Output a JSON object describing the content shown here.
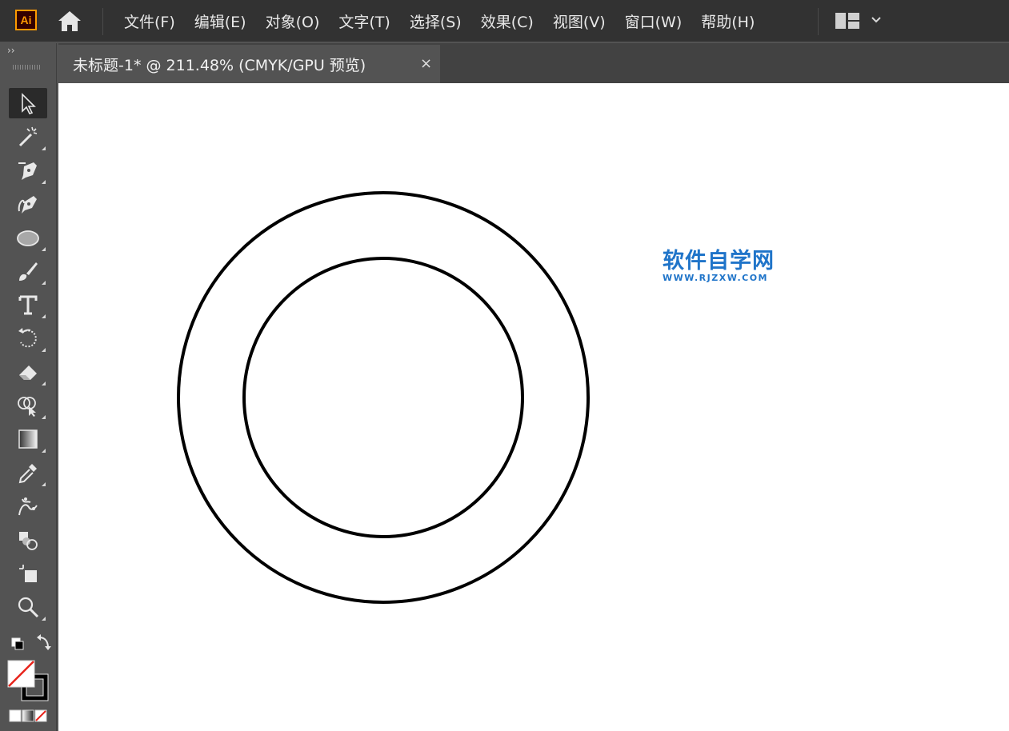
{
  "app": {
    "logo_text": "Ai",
    "colors": {
      "accent": "#ff9a00",
      "menubar_bg": "#323232",
      "panel_bg": "#535353",
      "watermark": "#1f74c9"
    }
  },
  "menu": {
    "items": [
      {
        "label": "文件(F)"
      },
      {
        "label": "编辑(E)"
      },
      {
        "label": "对象(O)"
      },
      {
        "label": "文字(T)"
      },
      {
        "label": "选择(S)"
      },
      {
        "label": "效果(C)"
      },
      {
        "label": "视图(V)"
      },
      {
        "label": "窗口(W)"
      },
      {
        "label": "帮助(H)"
      }
    ]
  },
  "toolbar": {
    "collapse_label": "››",
    "tools": [
      {
        "name": "selection-tool",
        "icon": "arrow-pointer-icon",
        "active": true
      },
      {
        "name": "magic-wand-tool",
        "icon": "magic-wand-icon"
      },
      {
        "name": "pen-tool",
        "icon": "pen-icon"
      },
      {
        "name": "curvature-tool",
        "icon": "curvature-pen-icon"
      },
      {
        "name": "ellipse-tool",
        "icon": "ellipse-icon"
      },
      {
        "name": "paintbrush-tool",
        "icon": "brush-icon"
      },
      {
        "name": "type-tool",
        "icon": "type-icon"
      },
      {
        "name": "rotate-tool",
        "icon": "rotate-icon"
      },
      {
        "name": "eraser-tool",
        "icon": "eraser-icon"
      },
      {
        "name": "shape-builder-tool",
        "icon": "shape-builder-icon"
      },
      {
        "name": "gradient-tool",
        "icon": "gradient-icon"
      },
      {
        "name": "eyedropper-tool",
        "icon": "eyedropper-icon"
      },
      {
        "name": "puppet-warp-tool",
        "icon": "puppet-warp-icon"
      },
      {
        "name": "blend-tool",
        "icon": "blend-icon"
      },
      {
        "name": "artboard-tool",
        "icon": "artboard-icon"
      },
      {
        "name": "zoom-tool",
        "icon": "zoom-icon"
      }
    ],
    "fill": "none",
    "stroke": "#000000"
  },
  "document": {
    "tab_title": "未标题-1* @ 211.48% (CMYK/GPU 预览)",
    "close_label": "×"
  },
  "watermark": {
    "title": "软件自学网",
    "url": "WWW.RJZXW.COM"
  }
}
